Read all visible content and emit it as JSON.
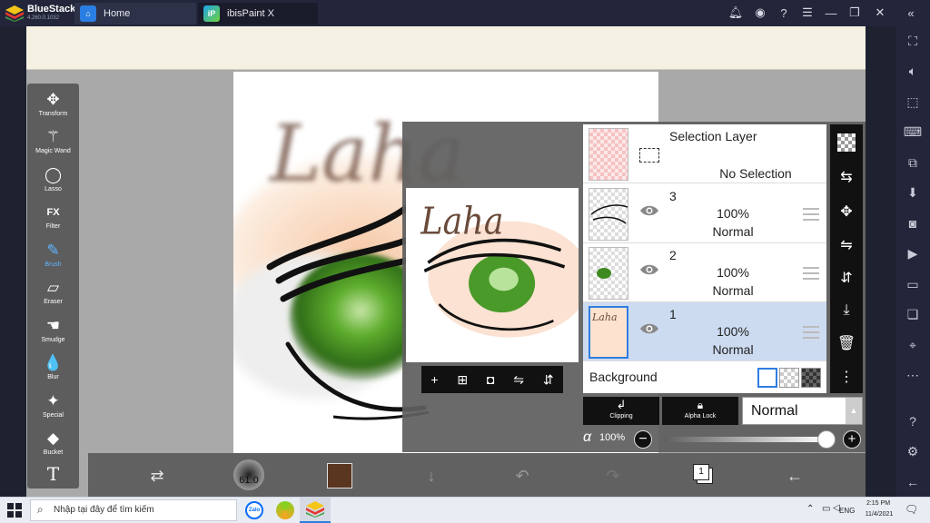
{
  "window": {
    "brand_name": "BlueStacks",
    "version": "4.260.0.1032",
    "tabs": [
      {
        "label": "Home",
        "icon": "home-icon"
      },
      {
        "label": "ibisPaint X",
        "icon": "ibispaint-icon"
      }
    ],
    "controls": [
      "bell-icon",
      "account-icon",
      "help-icon",
      "menu-icon",
      "minimize-icon",
      "restore-icon",
      "close-icon",
      "collapse-icon"
    ]
  },
  "right_sidebar": [
    "fullscreen-icon",
    "volume-icon",
    "pointer-icon",
    "keyboard-icon",
    "screen-record-icon",
    "install-apk-icon",
    "screenshot-icon",
    "video-icon",
    "folder-icon",
    "multi-instance-icon",
    "location-icon",
    "more-icon",
    "help-icon",
    "settings-icon",
    "back-icon"
  ],
  "canvas": {
    "text": "Laha",
    "colors": {
      "eye": "#4a9a2a",
      "stroke": "#111111",
      "text": "#6a4a3a"
    }
  },
  "toolbar": {
    "tools": [
      {
        "label": "Transform",
        "icon": "transform-icon",
        "glyph": "✥"
      },
      {
        "label": "Magic Wand",
        "icon": "magic-wand-icon",
        "glyph": "⚚"
      },
      {
        "label": "Lasso",
        "icon": "lasso-icon",
        "glyph": "◯"
      },
      {
        "label": "Filter",
        "icon": "filter-icon",
        "glyph": "FX"
      },
      {
        "label": "Brush",
        "icon": "brush-icon",
        "glyph": "✎"
      },
      {
        "label": "Eraser",
        "icon": "eraser-icon",
        "glyph": "▱"
      },
      {
        "label": "Smudge",
        "icon": "smudge-icon",
        "glyph": "☚"
      },
      {
        "label": "Blur",
        "icon": "blur-icon",
        "glyph": "💧"
      },
      {
        "label": "Special",
        "icon": "special-icon",
        "glyph": "✦"
      },
      {
        "label": "Bucket",
        "icon": "bucket-icon",
        "glyph": "◆"
      },
      {
        "label": "",
        "icon": "text-tool-icon",
        "glyph": "T"
      }
    ],
    "active": "Brush"
  },
  "bottom_bar": {
    "brush_size": "61.0",
    "color": "#5a3520",
    "layer_count": "1"
  },
  "layers_panel": {
    "selection_layer": {
      "title": "Selection Layer",
      "status": "No Selection"
    },
    "layers": [
      {
        "number": "3",
        "opacity": "100%",
        "mode": "Normal",
        "selected": false
      },
      {
        "number": "2",
        "opacity": "100%",
        "mode": "Normal",
        "selected": false
      },
      {
        "number": "1",
        "opacity": "100%",
        "mode": "Normal",
        "selected": true
      }
    ],
    "background_label": "Background",
    "clipping_label": "Clipping",
    "alpha_lock_label": "Alpha Lock",
    "blend_mode": "Normal",
    "alpha_symbol": "α",
    "opacity": "100%",
    "opacity_fraction": 1.0
  },
  "taskbar": {
    "search_placeholder": "Nhập tại đây để tìm kiếm",
    "time": "2:15 PM",
    "date": "11/4/2021",
    "language": "ENG"
  }
}
